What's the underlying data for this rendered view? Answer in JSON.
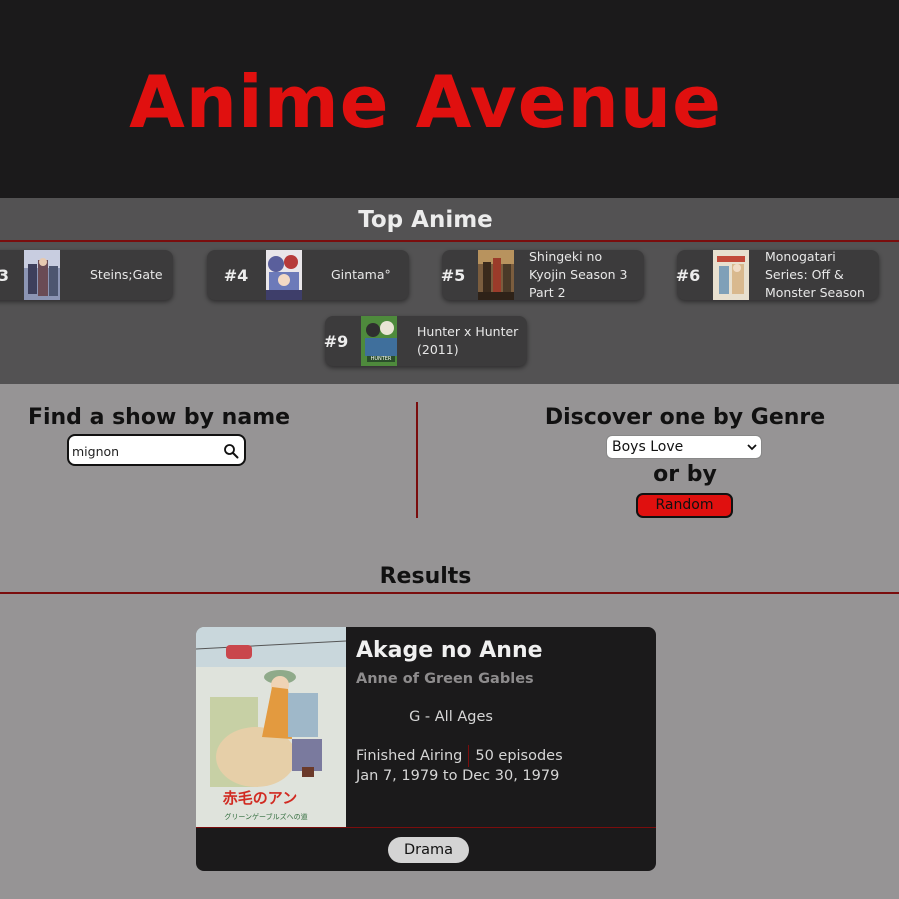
{
  "header": {
    "title": "Anime Avenue"
  },
  "top_anime": {
    "title": "Top Anime",
    "items": [
      {
        "rank": "3",
        "name": "Steins;Gate"
      },
      {
        "rank": "#4",
        "name": "Gintama°"
      },
      {
        "rank": "#5",
        "name": "Shingeki no Kyojin Season 3 Part 2"
      },
      {
        "rank": "#6",
        "name": "Monogatari Series: Off & Monster Season"
      },
      {
        "rank": "#9",
        "name": "Hunter x Hunter (2011)"
      }
    ]
  },
  "search": {
    "title": "Find a show by name",
    "value": "mignon",
    "icon": "search-icon"
  },
  "genre": {
    "title": "Discover one by Genre",
    "selected": "Boys Love",
    "or_by": "or by",
    "random_label": "Random"
  },
  "results": {
    "title": "Results",
    "items": [
      {
        "title": "Akage no Anne",
        "english_title": "Anne of Green Gables",
        "rating": "G - All Ages",
        "status": "Finished Airing",
        "episodes": "50 episodes",
        "dates": "Jan 7, 1979 to Dec 30, 1979",
        "genres": [
          "Drama"
        ],
        "poster_text": "赤毛のアン"
      }
    ]
  },
  "colors": {
    "accent": "#e0100f",
    "header_bg": "#1b1a1b",
    "top_bg": "#535253",
    "page_bg": "#969495",
    "rule": "#7a0d0d"
  }
}
